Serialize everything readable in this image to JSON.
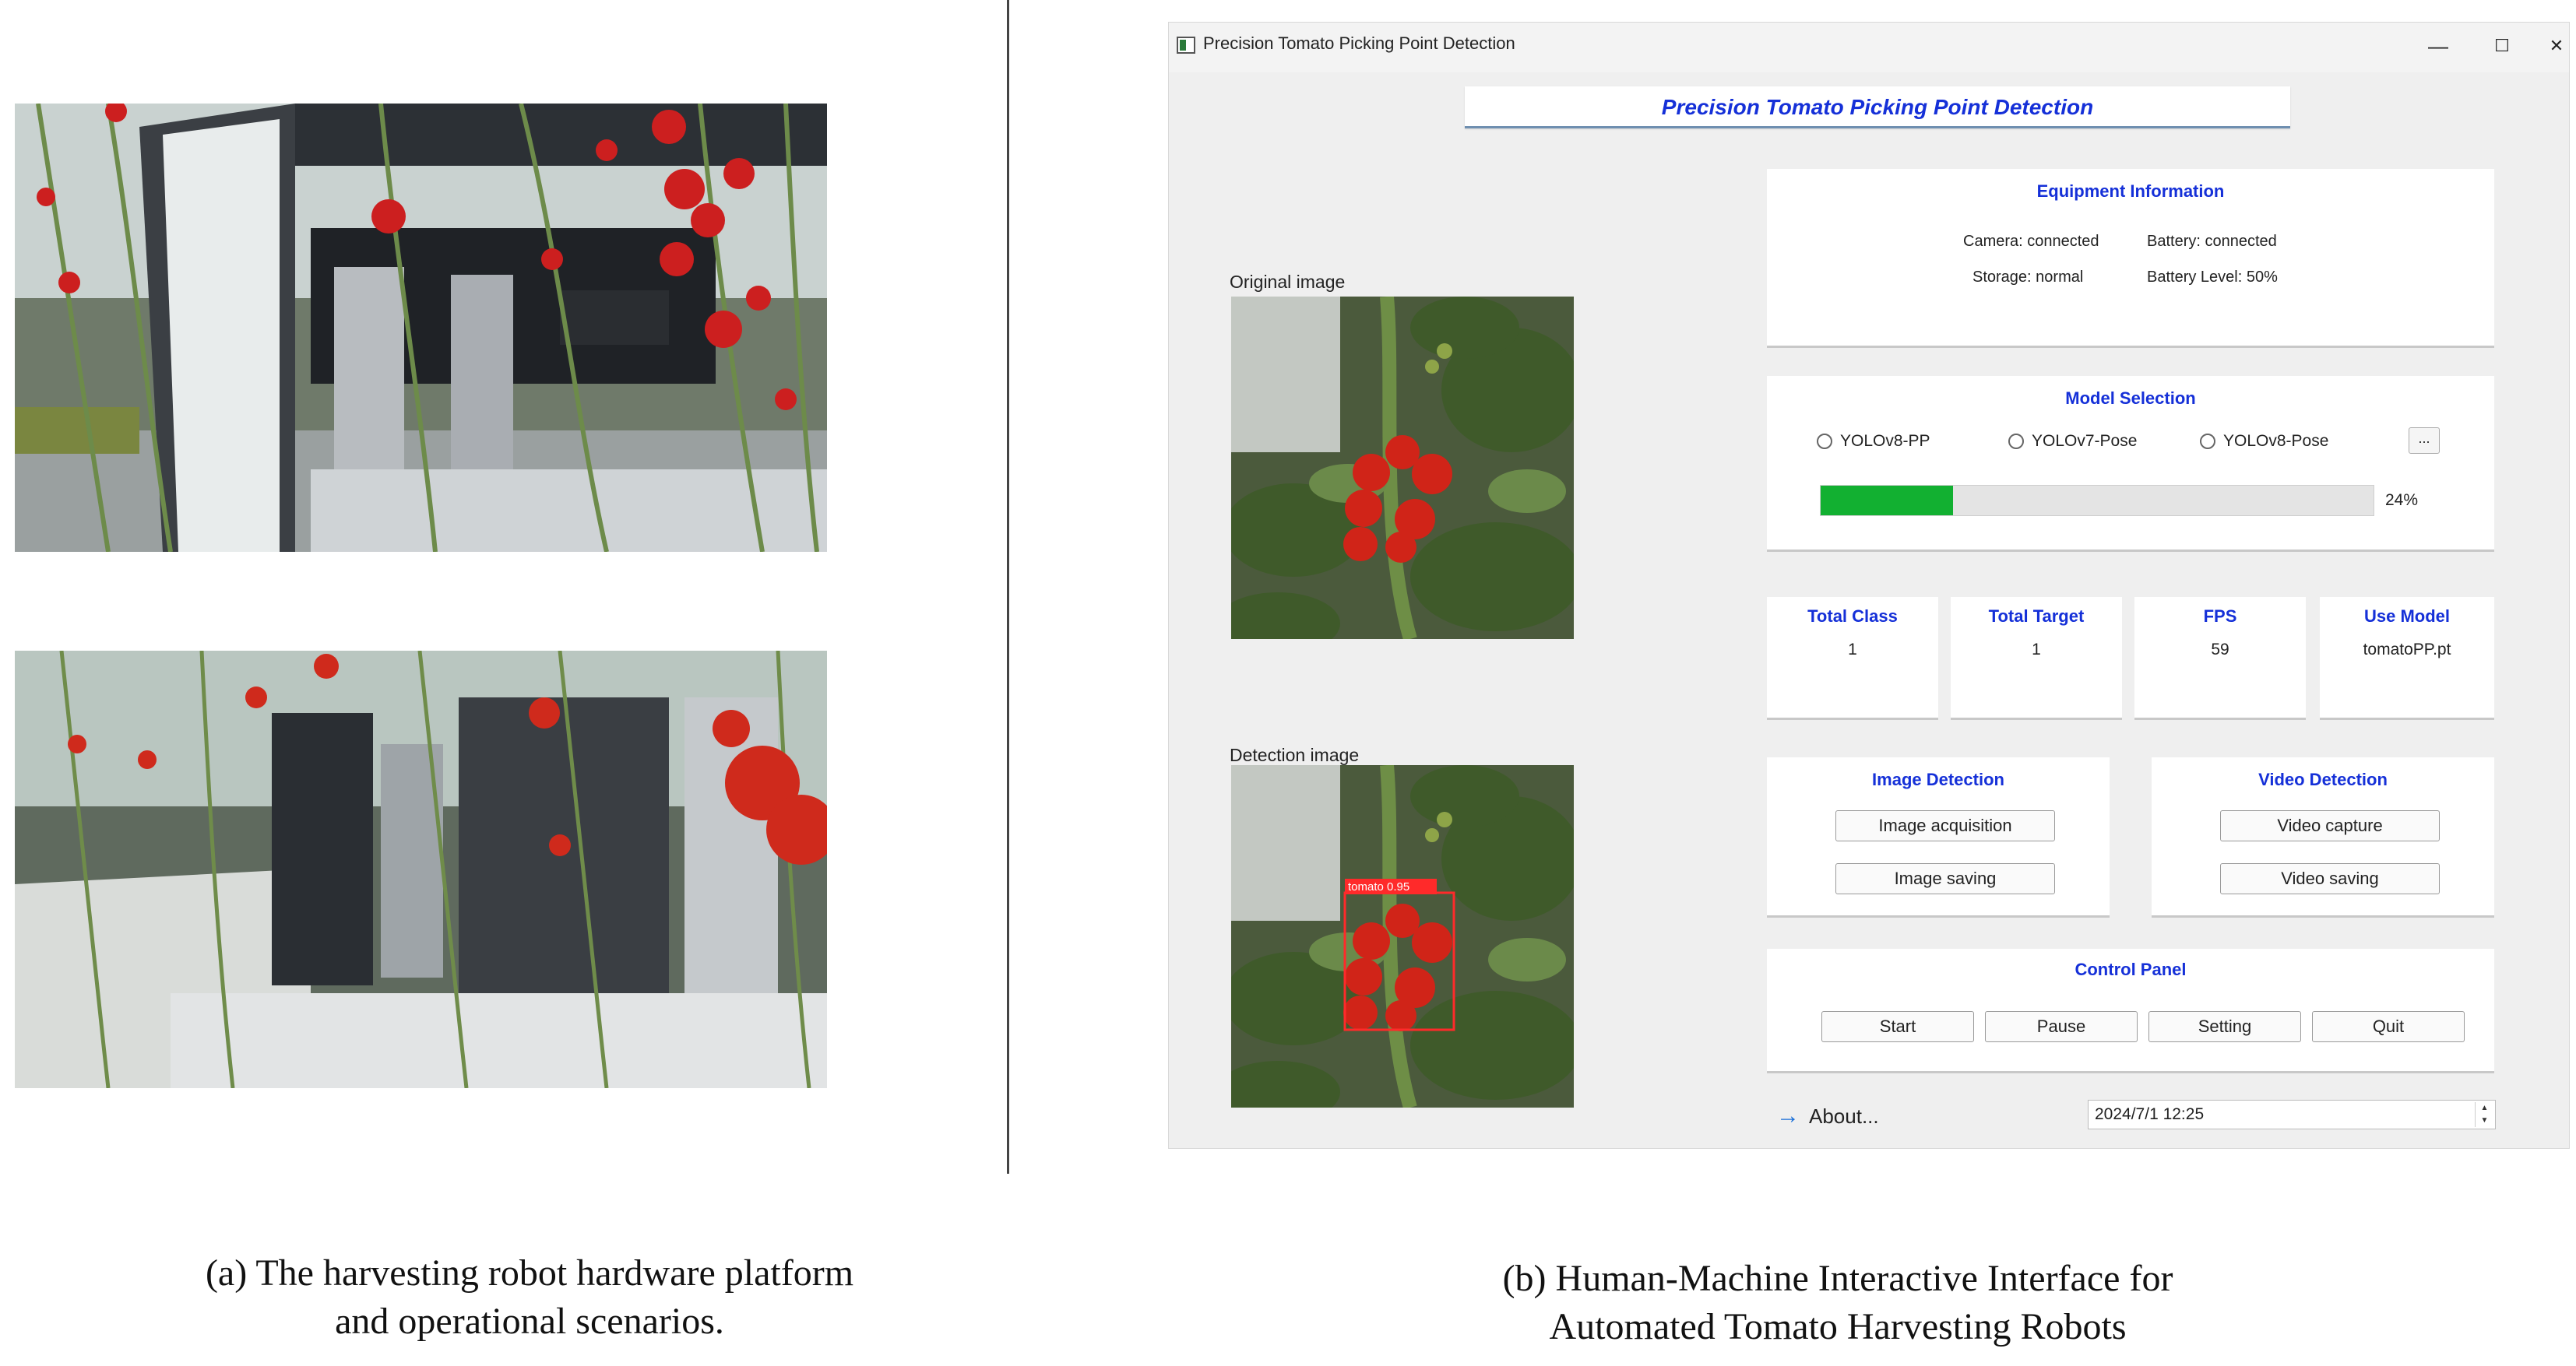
{
  "figure": {
    "caption_a_line1": "(a) The harvesting robot hardware platform",
    "caption_a_line2": "and operational scenarios.",
    "caption_b_line1": "(b) Human-Machine Interactive Interface for",
    "caption_b_line2": "Automated Tomato Harvesting Robots"
  },
  "window": {
    "title": "Precision Tomato Picking Point Detection",
    "minimize": "—",
    "maximize": "☐",
    "close": "✕"
  },
  "banner": {
    "title": "Precision Tomato Picking Point Detection"
  },
  "images": {
    "original_label": "Original image",
    "detection_label": "Detection image",
    "detection_box_label": "tomato  0.95"
  },
  "equipment": {
    "title": "Equipment Information",
    "camera": "Camera:  connected",
    "battery": "Battery:  connected",
    "storage": "Storage:  normal",
    "battery_level": "Battery Level:  50%"
  },
  "model_selection": {
    "title": "Model Selection",
    "options": [
      "YOLOv8-PP",
      "YOLOv7-Pose",
      "YOLOv8-Pose"
    ],
    "browse": "...",
    "progress_text": "24%",
    "progress": 0.24
  },
  "stats": [
    {
      "label": "Total Class",
      "value": "1"
    },
    {
      "label": "Total Target",
      "value": "1"
    },
    {
      "label": "FPS",
      "value": "59"
    },
    {
      "label": "Use Model",
      "value": "tomatoPP.pt"
    }
  ],
  "image_detection": {
    "title": "Image Detection",
    "acquire": "Image acquisition",
    "save": "Image saving"
  },
  "video_detection": {
    "title": "Video Detection",
    "capture": "Video capture",
    "save": "Video saving"
  },
  "control_panel": {
    "title": "Control Panel",
    "start": "Start",
    "pause": "Pause",
    "setting": "Setting",
    "quit": "Quit"
  },
  "footer": {
    "about_icon": "arrow-right-icon",
    "about": "About...",
    "datetime": "2024/7/1 12:25"
  },
  "colors": {
    "accent_blue": "#1530d8",
    "progress_green": "#12b031",
    "detection_box": "#ff2a2a"
  }
}
